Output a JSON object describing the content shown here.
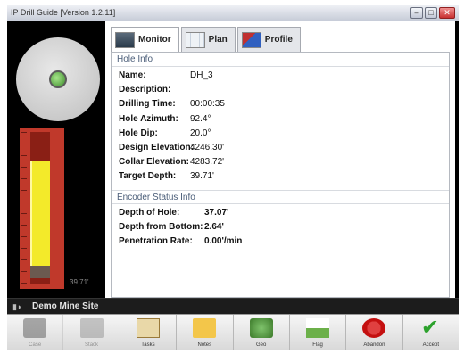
{
  "window": {
    "title": "IP Drill Guide [Version 1.2.11]"
  },
  "gauge": {
    "label": "39.71'",
    "fill_fraction": 0.78
  },
  "tabs": [
    {
      "label": "Monitor",
      "active": true,
      "icon": "monitor-icon"
    },
    {
      "label": "Plan",
      "active": false,
      "icon": "plan-icon"
    },
    {
      "label": "Profile",
      "active": false,
      "icon": "profile-icon"
    }
  ],
  "hole_info": {
    "heading": "Hole Info",
    "rows": [
      {
        "key": "Name:",
        "value": "DH_3"
      },
      {
        "key": "Description:",
        "value": ""
      },
      {
        "key": "Drilling Time:",
        "value": "00:00:35"
      },
      {
        "key": "Hole Azimuth:",
        "value": "92.4°"
      },
      {
        "key": "Hole Dip:",
        "value": "20.0°"
      },
      {
        "key": "Design Elevation:",
        "value": "4246.30'"
      },
      {
        "key": "Collar Elevation:",
        "value": "4283.72'"
      },
      {
        "key": "Target Depth:",
        "value": "39.71'"
      }
    ]
  },
  "encoder_info": {
    "heading": "Encoder Status Info",
    "rows": [
      {
        "key": "Depth of Hole:",
        "value": "37.07'"
      },
      {
        "key": "Depth from Bottom:",
        "value": "2.64'"
      },
      {
        "key": "Penetration Rate:",
        "value": "0.00'/min"
      }
    ]
  },
  "status": {
    "site": "Demo Mine Site"
  },
  "toolbar": [
    {
      "label": "Case",
      "icon": "case-icon",
      "enabled": false
    },
    {
      "label": "Stack",
      "icon": "stack-icon",
      "enabled": false
    },
    {
      "label": "Tasks",
      "icon": "tasks-icon",
      "enabled": true
    },
    {
      "label": "Notes",
      "icon": "notes-icon",
      "enabled": true
    },
    {
      "label": "Geo",
      "icon": "geo-icon",
      "enabled": true
    },
    {
      "label": "Flag",
      "icon": "flag-icon",
      "enabled": true
    },
    {
      "label": "Abandon",
      "icon": "abandon-icon",
      "enabled": true
    },
    {
      "label": "Accept",
      "icon": "accept-icon",
      "enabled": true
    }
  ],
  "colors": {
    "gauge_fill": "#f3ea2a",
    "gauge_frame": "#c0392b",
    "section_heading": "#4a5d78"
  }
}
